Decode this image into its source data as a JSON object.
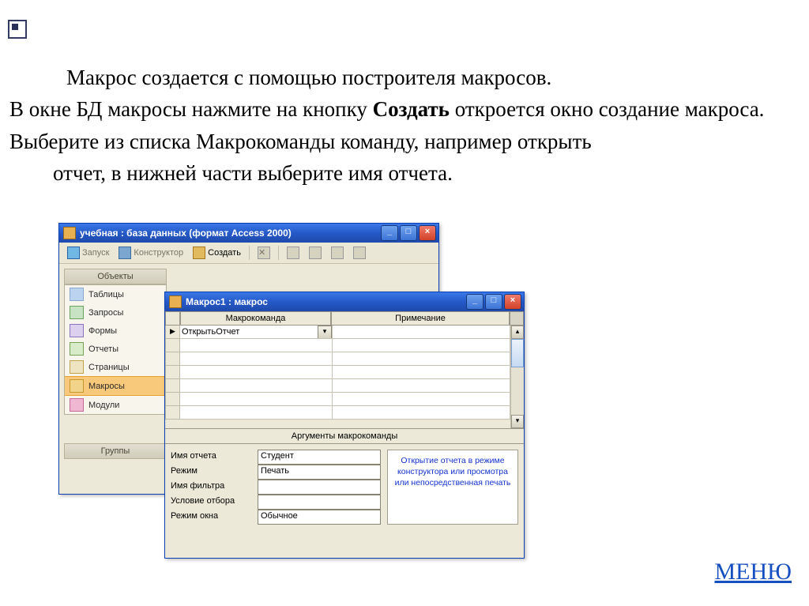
{
  "slide": {
    "p1": "Макрос создается с помощью построителя макросов.",
    "p2a": "В окне БД макросы нажмите на кнопку ",
    "p2b": "Создать",
    "p2c": " откроется окно создание макроса.",
    "p3": "Выберите из списка Макрокоманды команду, например открыть",
    "p4": "отчет, в нижней части выберите имя отчета.",
    "menu": "МЕНЮ"
  },
  "dbwin": {
    "title": "учебная : база данных (формат Access 2000)",
    "toolbar": {
      "run": "Запуск",
      "design": "Конструктор",
      "create": "Создать"
    },
    "nav": {
      "header": "Объекты",
      "items": [
        {
          "label": "Таблицы"
        },
        {
          "label": "Запросы"
        },
        {
          "label": "Формы"
        },
        {
          "label": "Отчеты"
        },
        {
          "label": "Страницы"
        },
        {
          "label": "Макросы"
        },
        {
          "label": "Модули"
        }
      ],
      "groups": "Группы"
    }
  },
  "macrowin": {
    "title": "Макрос1 : макрос",
    "columns": {
      "cmd": "Макрокоманда",
      "note": "Примечание"
    },
    "row0_cmd": "ОткрытьОтчет",
    "args_header": "Аргументы макрокоманды",
    "args": [
      {
        "label": "Имя отчета",
        "value": "Студент"
      },
      {
        "label": "Режим",
        "value": "Печать"
      },
      {
        "label": "Имя фильтра",
        "value": ""
      },
      {
        "label": "Условие отбора",
        "value": ""
      },
      {
        "label": "Режим окна",
        "value": "Обычное"
      }
    ],
    "help": "Открытие отчета в режиме конструктора или просмотра или непосредственная печать"
  }
}
